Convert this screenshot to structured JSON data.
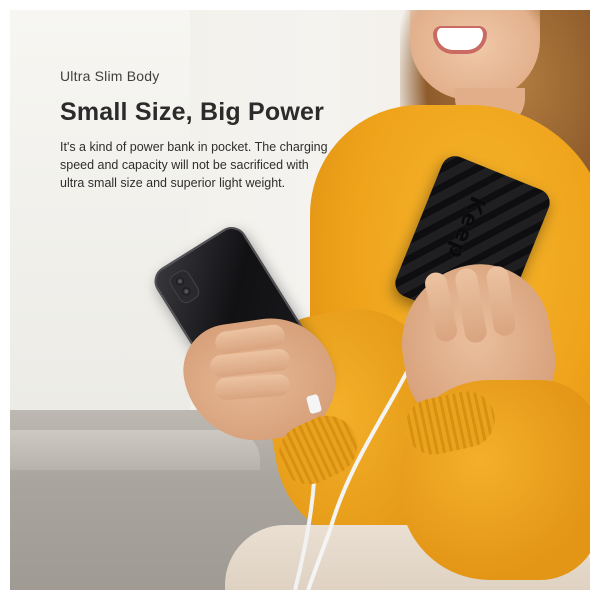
{
  "banner": {
    "eyebrow": "Ultra Slim Body",
    "headline": "Small Size, Big Power",
    "description_lines": [
      "It's a kind of power bank in pocket. The charging",
      "speed and capacity will not be sacrificed with",
      "ultra small size and superior light weight."
    ]
  },
  "product": {
    "brand_text": "Keep"
  },
  "colors": {
    "sweater": "#EEA21A",
    "powerbank": "#151517",
    "headline_text": "#2B2B2B",
    "background": "#F3F1EC"
  },
  "icons": {
    "cable": "usb-cable-icon"
  }
}
